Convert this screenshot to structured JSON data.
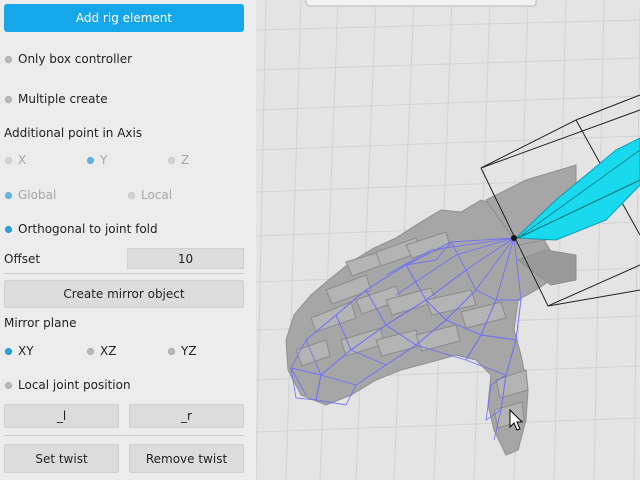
{
  "panel": {
    "add_rig_element": "Add rig element",
    "only_box_controller": "Only box controller",
    "multiple_create": "Multiple create",
    "additional_point_heading": "Additional point in Axis",
    "axis": {
      "x": "X",
      "y": "Y",
      "z": "Z",
      "selected": "Y"
    },
    "space": {
      "global": "Global",
      "local": "Local"
    },
    "orthogonal_to_joint_fold": "Orthogonal to joint fold",
    "offset_label": "Offset",
    "offset_value": "10",
    "create_mirror_object": "Create mirror object",
    "mirror_plane_heading": "Mirror plane",
    "mirror_plane": {
      "xy": "XY",
      "xz": "XZ",
      "yz": "YZ",
      "selected": "XY"
    },
    "local_joint_position": "Local joint position",
    "suffix_left": "_l",
    "suffix_right": "_r",
    "set_twist": "Set twist",
    "remove_twist": "Remove twist"
  },
  "viewport": {
    "colors": {
      "background": "#e4e4e4",
      "grid": "#d2d2d2",
      "mesh": "#a6a6a6",
      "wireframe": "#6b6bff",
      "controller": "#19d9ee"
    }
  }
}
